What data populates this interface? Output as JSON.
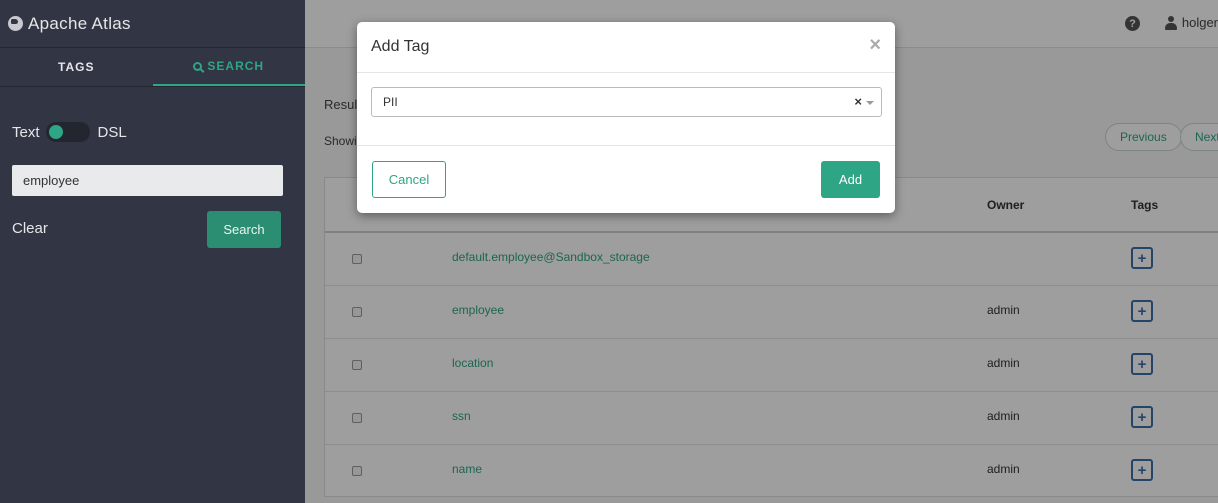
{
  "app": {
    "title": "Apache Atlas"
  },
  "sidebar": {
    "tabs": [
      {
        "label": "TAGS"
      },
      {
        "label": "SEARCH"
      }
    ],
    "toggle": {
      "left_label": "Text",
      "right_label": "DSL"
    },
    "search_value": "employee",
    "clear_label": "Clear",
    "search_button": "Search"
  },
  "header": {
    "help_symbol": "?",
    "user": "holger"
  },
  "main": {
    "results_label": "Resul",
    "showing_label": "Showi",
    "pager": {
      "previous": "Previous",
      "next": "Next"
    },
    "table": {
      "columns": {
        "owner": "Owner",
        "tags": "Tags"
      },
      "rows": [
        {
          "name": "default.employee@Sandbox_storage",
          "owner": ""
        },
        {
          "name": "employee",
          "owner": "admin"
        },
        {
          "name": "location",
          "owner": "admin"
        },
        {
          "name": "ssn",
          "owner": "admin"
        },
        {
          "name": "name",
          "owner": "admin"
        }
      ],
      "add_tag_symbol": "+"
    }
  },
  "modal": {
    "title": "Add Tag",
    "close_symbol": "×",
    "select_value": "PII",
    "select_clear": "×",
    "cancel_label": "Cancel",
    "add_label": "Add"
  },
  "colors": {
    "accent": "#2ea584",
    "sidebar_bg": "#323544",
    "tag_button": "#3b6ea8"
  }
}
